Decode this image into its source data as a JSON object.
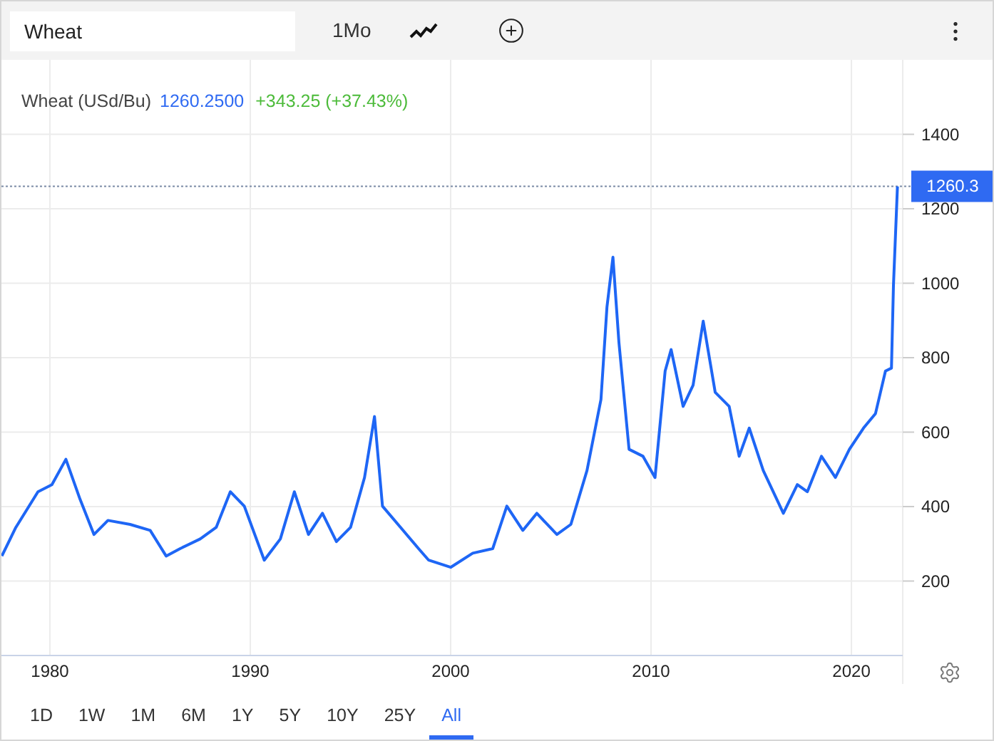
{
  "toolbar": {
    "symbol_field": {
      "value": "Wheat"
    },
    "interval": "1Mo"
  },
  "legend": {
    "price": "1260.2500",
    "change": "+343.25 (+37.43%)"
  },
  "chart_data": {
    "type": "line",
    "grid": true,
    "ref_lines": [
      {
        "axis": "y",
        "value": 1260.3,
        "label": "1260.3"
      }
    ],
    "xlim": [
      1977.58,
      2022.56
    ],
    "ylim": [
      0,
      1600
    ],
    "xticks": [
      1980,
      1990,
      2000,
      2010,
      2020
    ],
    "yticks": [
      200,
      400,
      600,
      800,
      1000,
      1200,
      1400
    ],
    "x": [
      1977.6,
      1978.3,
      1979.4,
      1980.1,
      1980.8,
      1981.5,
      1982.2,
      1982.9,
      1984,
      1985,
      1985.8,
      1986.5,
      1987.5,
      1988.3,
      1989,
      1989.7,
      1990.7,
      1991.5,
      1992.2,
      1992.9,
      1993.6,
      1994.3,
      1995,
      1995.7,
      1996.2,
      1996.6,
      1997.5,
      1998.4,
      1998.9,
      2000,
      2001.1,
      2002.1,
      2002.8,
      2003.6,
      2004.3,
      2005.3,
      2006,
      2006.8,
      2007.5,
      2007.8,
      2008.1,
      2008.4,
      2008.9,
      2009.6,
      2010.2,
      2010.7,
      2011,
      2011.6,
      2012.1,
      2012.6,
      2013.2,
      2013.9,
      2014.4,
      2014.9,
      2015.6,
      2016.6,
      2017.3,
      2017.8,
      2018.5,
      2019.2,
      2019.9,
      2020.6,
      2021.2,
      2021.7,
      2022,
      2022.1,
      2022.3
    ],
    "series": [
      {
        "name": "Wheat (USd/Bu)",
        "color": "#1e66f5",
        "values": [
          267,
          344,
          440,
          459,
          527,
          420,
          325,
          363,
          352,
          336,
          267,
          287,
          313,
          344,
          440,
          401,
          256,
          313,
          440,
          325,
          382,
          306,
          344,
          478,
          642,
          401,
          344,
          287,
          256,
          237,
          275,
          287,
          401,
          336,
          382,
          325,
          352,
          497,
          688,
          936,
          1070,
          841,
          554,
          535,
          478,
          764,
          822,
          669,
          726,
          898,
          707,
          669,
          535,
          611,
          497,
          382,
          459,
          440,
          535,
          478,
          554,
          611,
          650,
          764,
          772,
          994,
          1260
        ]
      }
    ]
  },
  "ranges": [
    {
      "label": "1D",
      "selected": false
    },
    {
      "label": "1W",
      "selected": false
    },
    {
      "label": "1M",
      "selected": false
    },
    {
      "label": "6M",
      "selected": false
    },
    {
      "label": "1Y",
      "selected": false
    },
    {
      "label": "5Y",
      "selected": false
    },
    {
      "label": "10Y",
      "selected": false
    },
    {
      "label": "25Y",
      "selected": false
    },
    {
      "label": "All",
      "selected": true
    }
  ]
}
